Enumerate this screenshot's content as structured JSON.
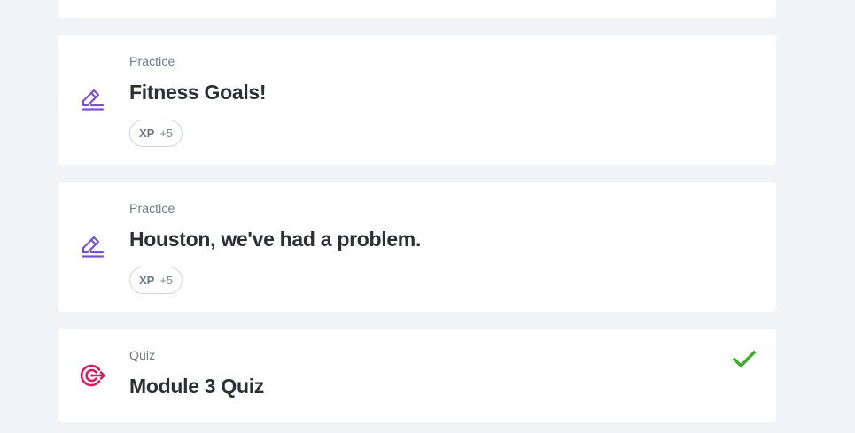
{
  "cards": [
    {
      "type": "Practice",
      "title": "Fitness Goals!",
      "icon": "pencil-edit-icon",
      "xp_label": "XP",
      "xp_value": "+5"
    },
    {
      "type": "Practice",
      "title": "Houston, we've had a problem.",
      "icon": "pencil-edit-icon",
      "xp_label": "XP",
      "xp_value": "+5"
    },
    {
      "type": "Quiz",
      "title": "Module 3 Quiz",
      "icon": "target-icon",
      "completed": true,
      "status_icon": "checkmark-icon"
    }
  ],
  "colors": {
    "background": "#f1f4f7",
    "card": "#ffffff",
    "practice_icon": "#7b4fd6",
    "quiz_icon": "#e0195f",
    "check": "#3fae2a",
    "title": "#2b2f36",
    "type_label": "#6a7a8c"
  }
}
